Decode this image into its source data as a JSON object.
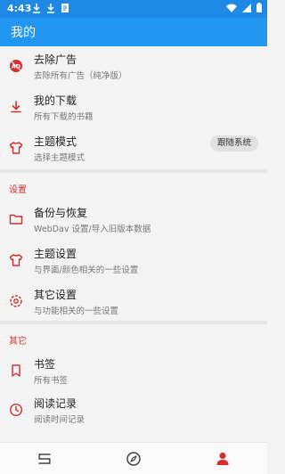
{
  "status_bar": {
    "time": "4:43",
    "notification_icons": [
      "download-icon",
      "download-icon",
      "file-icon"
    ],
    "system_icons": [
      "wifi-icon",
      "signal-icon",
      "battery-icon"
    ]
  },
  "app_bar": {
    "title": "我的"
  },
  "top_items": [
    {
      "title": "去除广告",
      "subtitle": "去除所有广告（纯净版）",
      "icon": "ad-off-icon"
    },
    {
      "title": "我的下载",
      "subtitle": "所有下载的书籍",
      "icon": "download-icon"
    },
    {
      "title": "主题模式",
      "subtitle": "选择主题模式",
      "icon": "tshirt-icon",
      "chip": "跟随系统"
    }
  ],
  "settings": {
    "header": "设置",
    "items": [
      {
        "title": "备份与恢复",
        "subtitle": "WebDav 设置/导入旧版本数据",
        "icon": "folder-icon"
      },
      {
        "title": "主题设置",
        "subtitle": "与界面/颜色相关的一些设置",
        "icon": "tshirt-icon"
      },
      {
        "title": "其它设置",
        "subtitle": "与功能相关的一些设置",
        "icon": "gear-icon"
      }
    ]
  },
  "other": {
    "header": "其它",
    "items": [
      {
        "title": "书签",
        "subtitle": "所有书签",
        "icon": "bookmark-icon"
      },
      {
        "title": "阅读记录",
        "subtitle": "阅读时间记录",
        "icon": "clock-icon"
      }
    ]
  },
  "bottom_nav": [
    {
      "name": "bookshelf-icon",
      "active": false
    },
    {
      "name": "compass-icon",
      "active": false
    },
    {
      "name": "person-icon",
      "active": true
    }
  ],
  "colors": {
    "primary": "#2196f3",
    "status_bar": "#1e88e5",
    "accent_red": "#d32f2f",
    "nav_inactive": "#444444"
  }
}
